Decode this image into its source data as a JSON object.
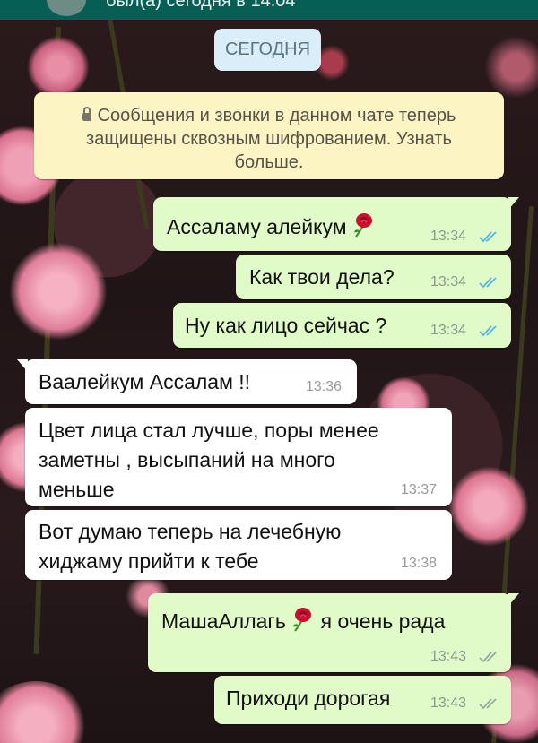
{
  "header": {
    "status_text": "был(а) сегодня в 14:04"
  },
  "date_chip": "СЕГОДНЯ",
  "encryption_notice": {
    "line1": "Сообщения и звонки в данном чате теперь",
    "line2": "защищены сквозным шифрованием. Узнать",
    "line3": "больше."
  },
  "messages": [
    {
      "direction": "outgoing",
      "text": "Ассаламу алейкум",
      "emoji": "rose",
      "time": "13:34",
      "status": "read"
    },
    {
      "direction": "outgoing",
      "text": "Как твои дела?",
      "time": "13:34",
      "status": "read"
    },
    {
      "direction": "outgoing",
      "text": "Ну как лицо сейчас ?",
      "time": "13:34",
      "status": "read"
    },
    {
      "direction": "incoming",
      "text": "Ваалейкум Ассалам !!",
      "time": "13:36"
    },
    {
      "direction": "incoming",
      "lines": [
        "Цвет лица стал лучше, поры менее",
        "заметны , высыпаний на много",
        "меньше"
      ],
      "time": "13:37"
    },
    {
      "direction": "incoming",
      "lines": [
        "Вот думаю теперь на лечебную",
        "хиджаму прийти к тебе"
      ],
      "time": "13:38"
    },
    {
      "direction": "outgoing",
      "text_before": "МашаАллагь",
      "emoji": "rose",
      "text_after": "я очень рада",
      "time": "13:43",
      "status": "delivered"
    },
    {
      "direction": "outgoing",
      "text": "Приходи дорогая",
      "time": "13:43",
      "status": "delivered"
    }
  ],
  "colors": {
    "outgoing_bubble": "#e1fbc8",
    "incoming_bubble": "#ffffff",
    "read_ticks": "#4fb3e8",
    "delivered_ticks": "#9aa79c",
    "notice_bg": "#fdf4c4",
    "date_chip_bg": "#d9eef8"
  }
}
